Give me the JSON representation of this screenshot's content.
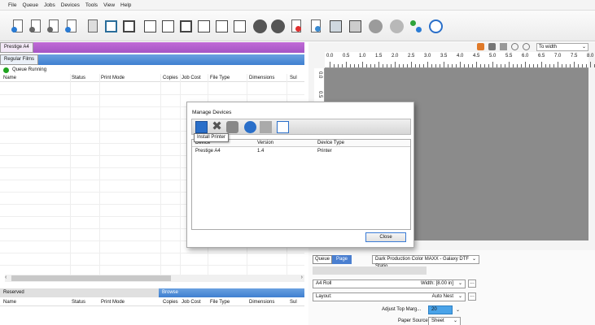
{
  "menu": [
    "File",
    "Queue",
    "Jobs",
    "Devices",
    "Tools",
    "View",
    "Help"
  ],
  "toolbar_icons": [
    "add-job-icon",
    "remove-job-icon",
    "copy-job-icon",
    "job-info-icon",
    "print-icon",
    "fit-icon",
    "layout-icon",
    "align-left-icon",
    "align-right-icon",
    "split-icon",
    "tile-icon",
    "crop-icon",
    "stop-icon",
    "cancel-icon",
    "send-icon",
    "send-queue-icon",
    "media-icon",
    "device-icon",
    "color-icon",
    "profile-icon",
    "network-icon",
    "clock-icon"
  ],
  "queues": {
    "printer_tab": "Prestige A4",
    "films_tab": "Regular Films",
    "status": "Queue Running",
    "colors": {
      "printer": "#b060cd",
      "films": "#4f8ad8",
      "running": "#1fa31f"
    }
  },
  "job_table": {
    "columns": [
      "Name",
      "Status",
      "Print Mode",
      "Copies",
      "Job Cost",
      "File Type",
      "Dimensions",
      "Sul"
    ]
  },
  "bottom": {
    "reserved": "Reserved",
    "browse": "Browse",
    "columns": [
      "Name",
      "Status",
      "Print Mode",
      "Copies",
      "Job Cost",
      "File Type",
      "Dimensions",
      "Sul"
    ]
  },
  "preview": {
    "zoom_fit": "To width",
    "ruler_labels": [
      "0.0",
      "0.5",
      "1.0",
      "1.5",
      "2.0",
      "2.5",
      "3.0",
      "3.5",
      "4.0",
      "4.5",
      "5.0",
      "5.5",
      "6.0",
      "6.5",
      "7.0",
      "7.5",
      "8.0"
    ],
    "vruler_labels": [
      "0.0",
      "0.5"
    ]
  },
  "properties": {
    "queue_tab": "Queue",
    "page_tab": "Page",
    "printer_profile": "Dark Production Color MAXX - Galaxy DTF Statio",
    "media": "A4 Roll",
    "width": "Width: [8.00 in]",
    "layout_label": "Layout:",
    "layout_value": "Auto Nest",
    "adjust_top_label": "Adjust Top Marg...",
    "adjust_top_value": "20",
    "paper_source_label": "Paper Source",
    "paper_source_value": "Sheet"
  },
  "dialog": {
    "title": "Manage Devices",
    "tooltip": "Install Printer",
    "columns": [
      "Device",
      "Version",
      "Device Type"
    ],
    "rows": [
      {
        "device": "Prestige A4",
        "version": "1.4",
        "type": "Printer"
      }
    ],
    "close": "Close"
  }
}
